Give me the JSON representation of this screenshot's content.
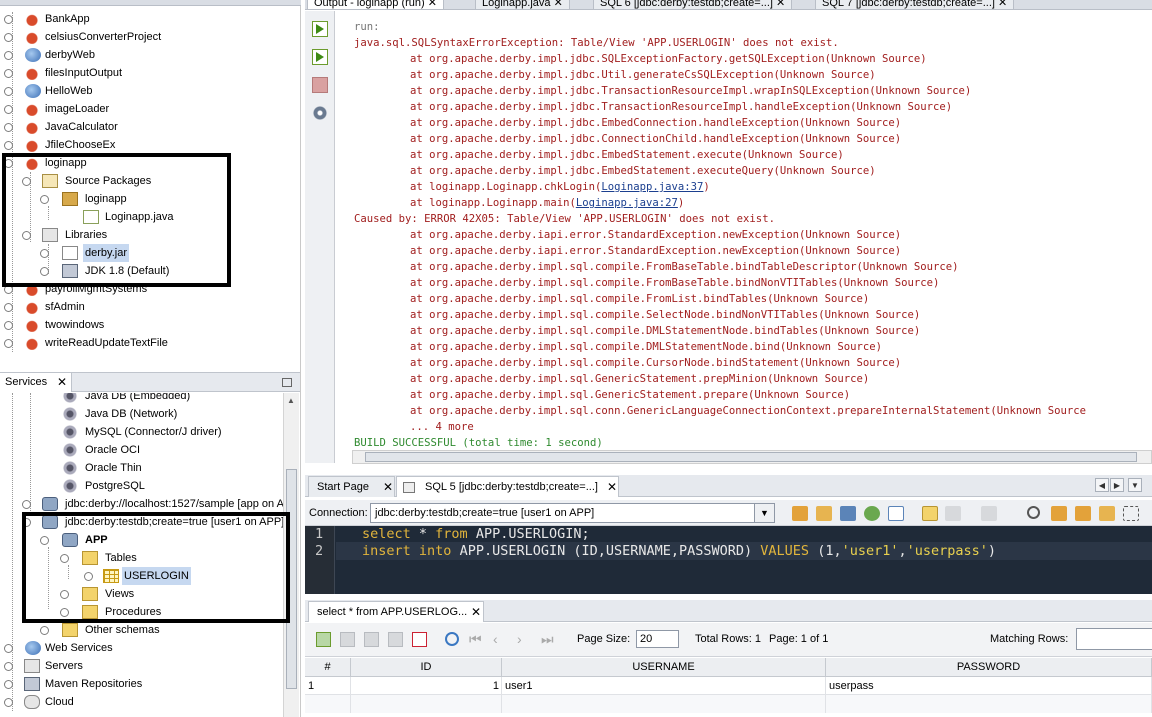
{
  "projects": {
    "items": [
      {
        "label": "BankApp"
      },
      {
        "label": "celsiusConverterProject"
      },
      {
        "label": "derbyWeb"
      },
      {
        "label": "filesInputOutput"
      },
      {
        "label": "HelloWeb"
      },
      {
        "label": "imageLoader"
      },
      {
        "label": "JavaCalculator"
      },
      {
        "label": "JfileChooseEx"
      },
      {
        "label": "loginapp"
      },
      {
        "label": "Source Packages"
      },
      {
        "label": "loginapp"
      },
      {
        "label": "Loginapp.java"
      },
      {
        "label": "Libraries"
      },
      {
        "label": "derby.jar"
      },
      {
        "label": "JDK 1.8 (Default)"
      },
      {
        "label": "payrollMgmtSystems"
      },
      {
        "label": "sfAdmin"
      },
      {
        "label": "twowindows"
      },
      {
        "label": "writeReadUpdateTextFile"
      }
    ]
  },
  "services": {
    "tab_label": "Services",
    "items": [
      {
        "label": "Java DB (Embedded)"
      },
      {
        "label": "Java DB (Network)"
      },
      {
        "label": "MySQL (Connector/J driver)"
      },
      {
        "label": "Oracle OCI"
      },
      {
        "label": "Oracle Thin"
      },
      {
        "label": "PostgreSQL"
      },
      {
        "label": "jdbc:derby://localhost:1527/sample [app on A"
      },
      {
        "label": "jdbc:derby:testdb;create=true [user1 on APP]"
      },
      {
        "label": "APP"
      },
      {
        "label": "Tables"
      },
      {
        "label": "USERLOGIN"
      },
      {
        "label": "Views"
      },
      {
        "label": "Procedures"
      },
      {
        "label": "Other schemas"
      },
      {
        "label": "Web Services"
      },
      {
        "label": "Servers"
      },
      {
        "label": "Maven Repositories"
      },
      {
        "label": "Cloud"
      }
    ]
  },
  "output": {
    "tabs": [
      "Output - loginapp (run)",
      "Loginapp.java",
      "SQL 6 [jdbc:derby:testdb;create=...]",
      "SQL 7 [jdbc:derby:testdb;create=...]"
    ],
    "lines": [
      {
        "text": "run:",
        "kind": "gray",
        "indent": 0
      },
      {
        "text": "java.sql.SQLSyntaxErrorException: Table/View 'APP.USERLOGIN' does not exist.",
        "kind": "err",
        "indent": 0
      },
      {
        "text": "at org.apache.derby.impl.jdbc.SQLExceptionFactory.getSQLException(Unknown Source)",
        "kind": "err",
        "indent": 1
      },
      {
        "text": "at org.apache.derby.impl.jdbc.Util.generateCsSQLException(Unknown Source)",
        "kind": "err",
        "indent": 1
      },
      {
        "text": "at org.apache.derby.impl.jdbc.TransactionResourceImpl.wrapInSQLException(Unknown Source)",
        "kind": "err",
        "indent": 1
      },
      {
        "text": "at org.apache.derby.impl.jdbc.TransactionResourceImpl.handleException(Unknown Source)",
        "kind": "err",
        "indent": 1
      },
      {
        "text": "at org.apache.derby.impl.jdbc.EmbedConnection.handleException(Unknown Source)",
        "kind": "err",
        "indent": 1
      },
      {
        "text": "at org.apache.derby.impl.jdbc.ConnectionChild.handleException(Unknown Source)",
        "kind": "err",
        "indent": 1
      },
      {
        "text": "at org.apache.derby.impl.jdbc.EmbedStatement.execute(Unknown Source)",
        "kind": "err",
        "indent": 1
      },
      {
        "text": "at org.apache.derby.impl.jdbc.EmbedStatement.executeQuery(Unknown Source)",
        "kind": "err",
        "indent": 1
      },
      {
        "text": "at loginapp.Loginapp.chkLogin(",
        "link": "Loginapp.java:37",
        "after": ")",
        "kind": "err",
        "indent": 1
      },
      {
        "text": "at loginapp.Loginapp.main(",
        "link": "Loginapp.java:27",
        "after": ")",
        "kind": "err",
        "indent": 1
      },
      {
        "text": "Caused by: ERROR 42X05: Table/View 'APP.USERLOGIN' does not exist.",
        "kind": "err",
        "indent": 0
      },
      {
        "text": "at org.apache.derby.iapi.error.StandardException.newException(Unknown Source)",
        "kind": "err",
        "indent": 1
      },
      {
        "text": "at org.apache.derby.iapi.error.StandardException.newException(Unknown Source)",
        "kind": "err",
        "indent": 1
      },
      {
        "text": "at org.apache.derby.impl.sql.compile.FromBaseTable.bindTableDescriptor(Unknown Source)",
        "kind": "err",
        "indent": 1
      },
      {
        "text": "at org.apache.derby.impl.sql.compile.FromBaseTable.bindNonVTITables(Unknown Source)",
        "kind": "err",
        "indent": 1
      },
      {
        "text": "at org.apache.derby.impl.sql.compile.FromList.bindTables(Unknown Source)",
        "kind": "err",
        "indent": 1
      },
      {
        "text": "at org.apache.derby.impl.sql.compile.SelectNode.bindNonVTITables(Unknown Source)",
        "kind": "err",
        "indent": 1
      },
      {
        "text": "at org.apache.derby.impl.sql.compile.DMLStatementNode.bindTables(Unknown Source)",
        "kind": "err",
        "indent": 1
      },
      {
        "text": "at org.apache.derby.impl.sql.compile.DMLStatementNode.bind(Unknown Source)",
        "kind": "err",
        "indent": 1
      },
      {
        "text": "at org.apache.derby.impl.sql.compile.CursorNode.bindStatement(Unknown Source)",
        "kind": "err",
        "indent": 1
      },
      {
        "text": "at org.apache.derby.impl.sql.GenericStatement.prepMinion(Unknown Source)",
        "kind": "err",
        "indent": 1
      },
      {
        "text": "at org.apache.derby.impl.sql.GenericStatement.prepare(Unknown Source)",
        "kind": "err",
        "indent": 1
      },
      {
        "text": "at org.apache.derby.impl.sql.conn.GenericLanguageConnectionContext.prepareInternalStatement(Unknown Source",
        "kind": "err",
        "indent": 1
      },
      {
        "text": "... 4 more",
        "kind": "err",
        "indent": 1
      },
      {
        "text": "BUILD SUCCESSFUL (total time: 1 second)",
        "kind": "green",
        "indent": 0
      }
    ]
  },
  "editor": {
    "tabs": [
      "Start Page",
      "SQL 5 [jdbc:derby:testdb;create=...]"
    ],
    "connection_label": "Connection:",
    "connection_value": "jdbc:derby:testdb;create=true [user1 on APP]",
    "line_numbers": [
      "1",
      "2"
    ],
    "line1": {
      "k1": "select",
      "p1": " * ",
      "k2": "from",
      "p2": " APP.USERLOGIN;"
    },
    "line2": {
      "k1": "insert",
      "p1": " ",
      "k2": "into",
      "p2": " APP.USERLOGIN (ID,USERNAME,PASSWORD) ",
      "k3": "VALUES",
      "p3": " (1,",
      "s1": "'user1'",
      "c1": ",",
      "s2": "'userpass'",
      "p4": ")"
    }
  },
  "results": {
    "tab_label": "select * from APP.USERLOG...",
    "page_size_label": "Page Size:",
    "page_size_value": "20",
    "total_rows": "Total Rows:  1",
    "page_info": "Page: 1 of 1",
    "matching_rows_label": "Matching Rows:",
    "columns": [
      "#",
      "ID",
      "USERNAME",
      "PASSWORD"
    ],
    "rows": [
      [
        "1",
        "1",
        "user1",
        "userpass"
      ]
    ]
  },
  "colors": {
    "error_text": "#a11e1e",
    "success_text": "#2f8a2f",
    "editor_bg": "#1f2a38",
    "keyword": "#e2b53c",
    "selection": "#c6d8f0"
  }
}
